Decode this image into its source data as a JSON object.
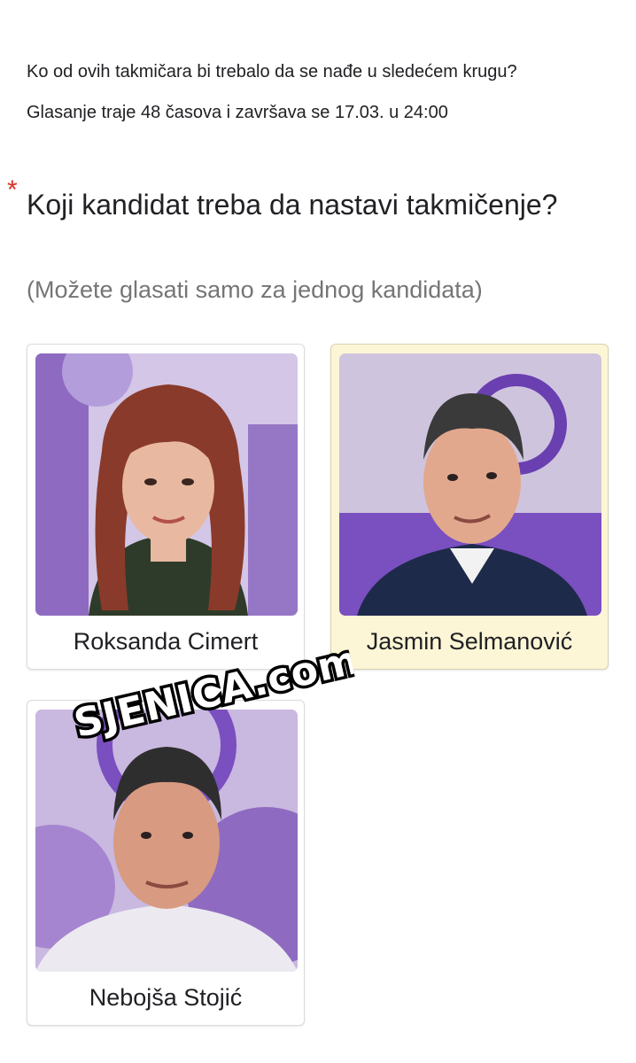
{
  "intro": {
    "line1": "Ko od ovih takmičara bi trebalo da se nađe u sledećem krugu?",
    "line2": "Glasanje traje 48 časova i završava se 17.03. u 24:00"
  },
  "question": {
    "required_mark": "*",
    "title": "Koji kandidat treba da nastavi takmičenje?",
    "hint": "(Možete glasati samo za jednog kandidata)"
  },
  "candidates": [
    {
      "name": "Roksanda Cimert",
      "selected": false
    },
    {
      "name": "Jasmin Selmanović",
      "selected": true
    },
    {
      "name": "Nebojša Stojić",
      "selected": false
    }
  ],
  "watermark": "SJENICA.com",
  "colors": {
    "selected_card_bg": "#fdf6d6",
    "photo_purple": "#8e6bc0",
    "photo_lilac": "#c9b8e0",
    "required_red": "#d93025"
  }
}
